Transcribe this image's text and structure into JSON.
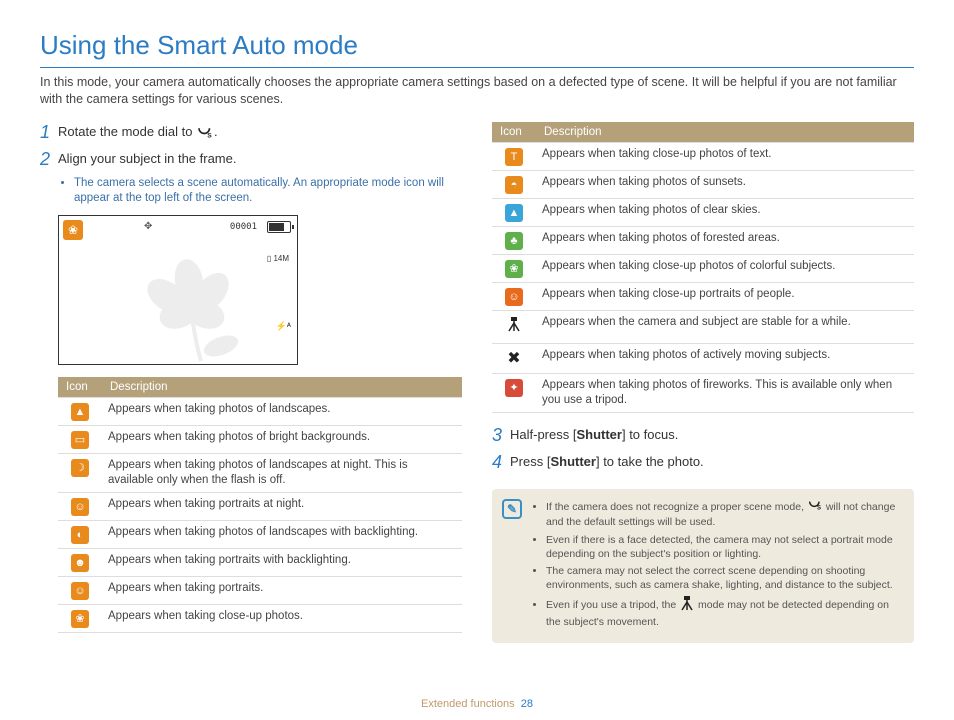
{
  "title": "Using the Smart Auto mode",
  "intro": "In this mode, your camera automatically chooses the appropriate camera settings based on a defected type of scene. It will be helpful if you are not familiar with the camera settings for various scenes.",
  "steps": {
    "s1_pre": "Rotate the mode dial to ",
    "s1_post": ".",
    "s2": "Align your subject in the frame.",
    "s2_bullet": "The camera selects a scene automatically. An appropriate mode icon will appear at the top left of the screen.",
    "s3_pre": "Half-press [",
    "s3_bold": "Shutter",
    "s3_post": "] to focus.",
    "s4_pre": "Press [",
    "s4_bold": "Shutter",
    "s4_post": "] to take the photo."
  },
  "lcd": {
    "counter": "00001",
    "res": "14M"
  },
  "table_headers": {
    "icon": "Icon",
    "desc": "Description"
  },
  "left_table": [
    {
      "sym": "▲",
      "cls": "orange",
      "desc": "Appears when taking photos of landscapes."
    },
    {
      "sym": "▭",
      "cls": "orange",
      "desc": "Appears when taking photos of bright backgrounds."
    },
    {
      "sym": "☽",
      "cls": "orange",
      "desc": "Appears when taking photos of landscapes at night. This is available only when the flash is off."
    },
    {
      "sym": "☺",
      "cls": "orange",
      "desc": "Appears when taking portraits at night."
    },
    {
      "sym": "◐",
      "cls": "orange",
      "desc": "Appears when taking photos of landscapes with backlighting."
    },
    {
      "sym": "☻",
      "cls": "orange",
      "desc": "Appears when taking portraits with backlighting."
    },
    {
      "sym": "☺",
      "cls": "orange",
      "desc": "Appears when taking portraits."
    },
    {
      "sym": "❀",
      "cls": "orange",
      "desc": "Appears when taking close-up photos."
    }
  ],
  "right_table": [
    {
      "sym": "T",
      "cls": "orange",
      "desc": "Appears when taking close-up photos of text."
    },
    {
      "sym": "◓",
      "cls": "orange",
      "desc": "Appears when taking photos of sunsets."
    },
    {
      "sym": "▲",
      "cls": "blue",
      "desc": "Appears when taking photos of clear skies."
    },
    {
      "sym": "♣",
      "cls": "green",
      "desc": "Appears when taking photos of forested areas."
    },
    {
      "sym": "❀",
      "cls": "green",
      "desc": "Appears when taking close-up photos of colorful subjects."
    },
    {
      "sym": "☺",
      "cls": "darkorange",
      "desc": "Appears when taking close-up portraits of people."
    },
    {
      "sym": "tripod",
      "cls": "black-txt",
      "desc": "Appears when the camera and subject are stable for a while."
    },
    {
      "sym": "✖",
      "cls": "black-txt",
      "desc": "Appears when taking photos of actively moving subjects."
    },
    {
      "sym": "✦",
      "cls": "red",
      "desc": "Appears when taking photos of fireworks. This is available only when you use a tripod."
    }
  ],
  "notes": [
    {
      "pre": "If the camera does not recognize a proper scene mode, ",
      "icon": true,
      "post": " will not change and the default settings will be used."
    },
    {
      "text": "Even if there is a face detected, the camera may not select a portrait mode depending on the subject's position or lighting."
    },
    {
      "text": "The camera may not select the correct scene depending on shooting environments, such as camera shake, lighting, and distance to the subject."
    },
    {
      "pre": "Even if you use a tripod, the ",
      "tripod": true,
      "post": " mode may not be detected depending on the subject's movement."
    }
  ],
  "footer": {
    "section": "Extended functions",
    "page": "28"
  }
}
